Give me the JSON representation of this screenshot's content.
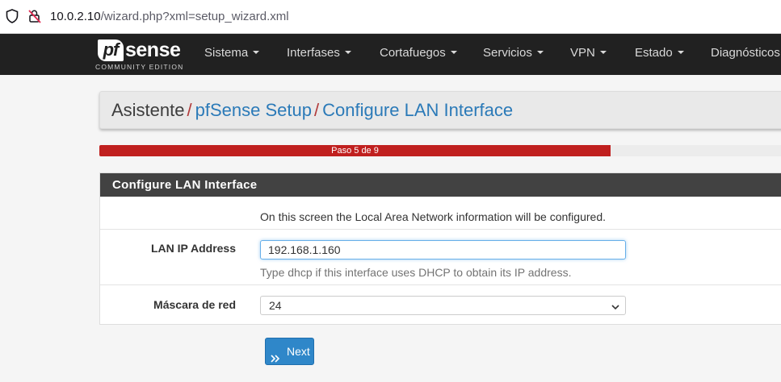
{
  "browser": {
    "url_host": "10.0.2.10",
    "url_path": "/wizard.php?xml=setup_wizard.xml"
  },
  "logo": {
    "pf": "pf",
    "sense": "sense",
    "edition": "COMMUNITY EDITION"
  },
  "nav": {
    "items": [
      "Sistema",
      "Interfases",
      "Cortafuegos",
      "Servicios",
      "VPN",
      "Estado",
      "Diagnósticos"
    ]
  },
  "breadcrumb": {
    "root": "Asistente",
    "separator": "/",
    "level1": "pfSense Setup",
    "level2": "Configure LAN Interface"
  },
  "progress": {
    "label": "Paso 5 de 9",
    "current_step": 5,
    "total_steps": 9
  },
  "panel": {
    "title": "Configure LAN Interface",
    "intro": "On this screen the Local Area Network information will be configured.",
    "lan_ip": {
      "label": "LAN IP Address",
      "value": "192.168.1.160",
      "help": "Type dhcp if this interface uses DHCP to obtain its IP address."
    },
    "subnet": {
      "label": "Máscara de red",
      "selected": "24"
    }
  },
  "next_button": {
    "label": "Next"
  },
  "colors": {
    "navbar": "#212121",
    "progress_fill": "#c0201f",
    "panel_heading": "#424242",
    "link": "#2b7ab8",
    "button": "#2f87c9"
  }
}
